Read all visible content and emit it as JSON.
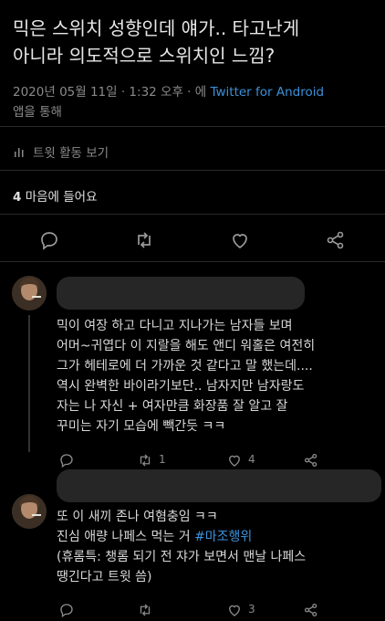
{
  "tweet": {
    "text_line1": "믹은 스위치 성향인데 얘가.. 타고난게",
    "text_line2": "아니라 의도적으로 스위치인 느낌?",
    "timestamp": "2020년 05월 11일 · 1:32 오후 · 에",
    "source_link": "Twitter for Android",
    "source_suffix": "앱을 통해",
    "activity_label": "트윗 활동 보기",
    "likes_count": "4",
    "likes_label": "마음에 들어요"
  },
  "replies": [
    {
      "lines": [
        "믹이 여장 하고 다니고 지나가는 남자들 보며",
        "어머~귀엽다 이 지랄을 해도 앤디 워홀은 여전히",
        "그가 헤테로에 더 가까운 것 같다고 말 했는데....",
        "역시 완벽한 바이라기보단.. 남자지만 남자랑도",
        "자는 나 자신 + 여자만큼 화장품 잘 알고 잘",
        "꾸미는 자기 모습에 빽간듯 ㅋㅋ"
      ],
      "retweets": "1",
      "likes": "4"
    },
    {
      "line1": "또 이 새끼 존나 여혐충임 ㅋㅋ",
      "line2_prefix": "진심 애량 나페스 먹는 거 ",
      "line2_hashtag": "#마조행위",
      "line3": "(휴롬특: 챙롬 되기 전 쟈가 보면서 맨날 나페스",
      "line4": "땡긴다고 트윗 씀)",
      "likes": "3"
    }
  ],
  "colors": {
    "background": "#000000",
    "link": "#3c90d8",
    "muted": "#8a8a8a"
  }
}
